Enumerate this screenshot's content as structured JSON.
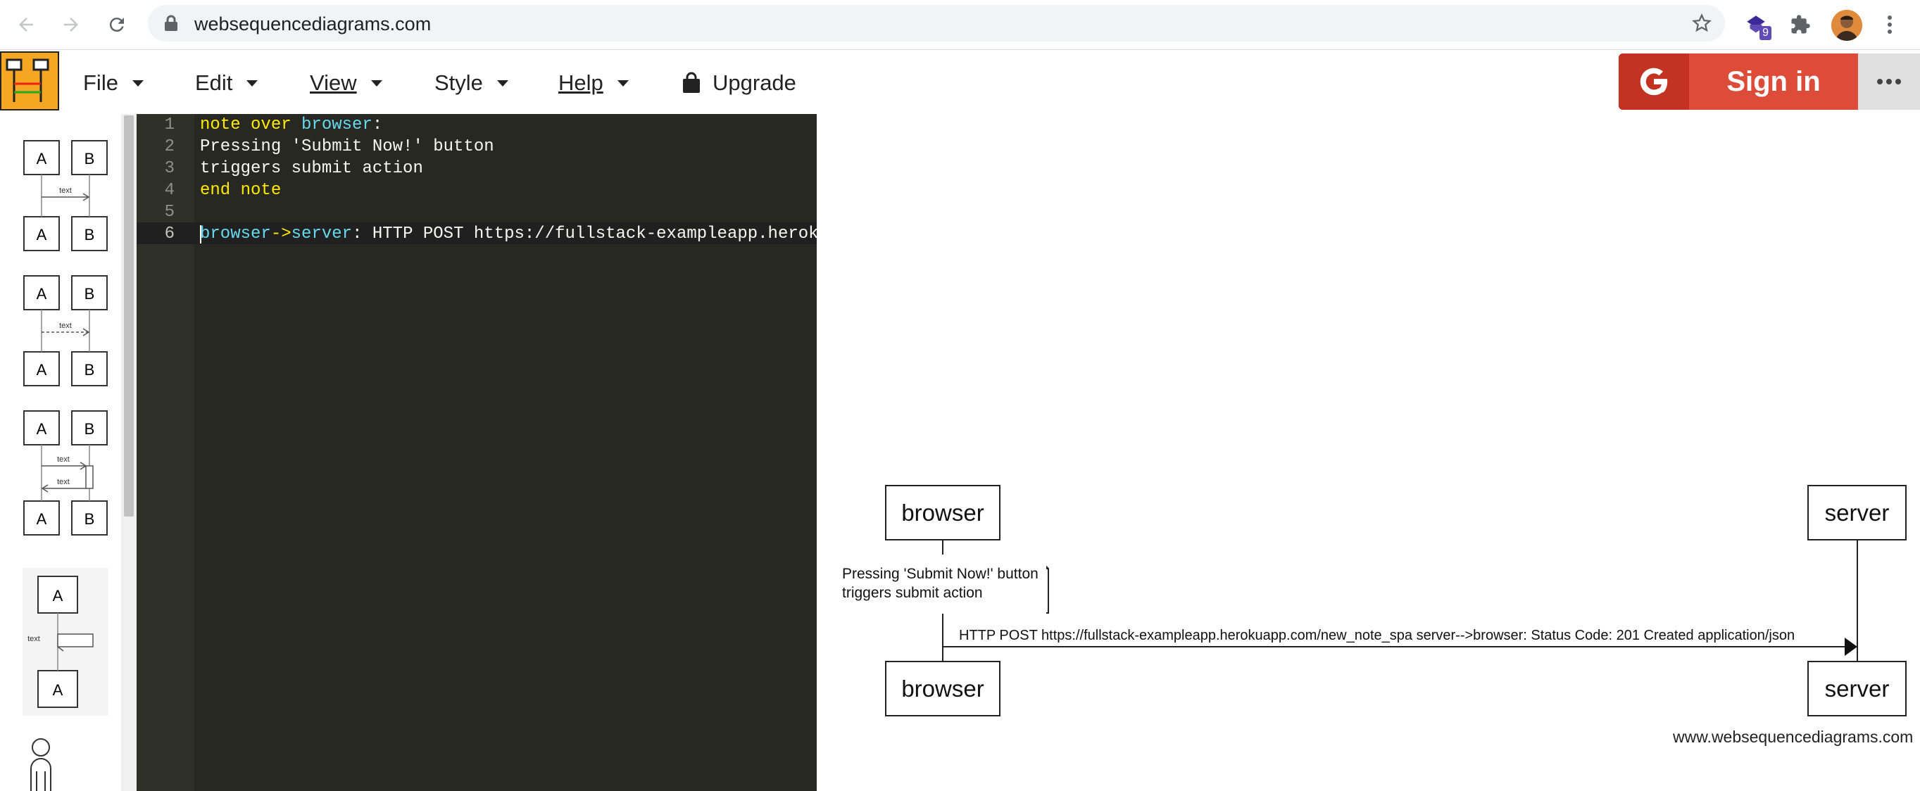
{
  "browser": {
    "url": "websequencediagrams.com",
    "extension_badge": "9",
    "icons": [
      "back-arrow-icon",
      "forward-arrow-icon",
      "reload-icon",
      "lock-icon",
      "bookmark-star-icon",
      "extension-icon",
      "puzzle-icon",
      "kebab-menu-icon"
    ]
  },
  "app": {
    "menu": {
      "file": "File",
      "edit": "Edit",
      "view": "View",
      "style": "Style",
      "help": "Help",
      "upgrade": "Upgrade"
    },
    "signin_label": "Sign in",
    "accent": "#dd4b39"
  },
  "templates": [
    {
      "top": "A",
      "top2": "B",
      "bottom": "A",
      "bottom2": "B",
      "label": "text"
    },
    {
      "top": "A",
      "top2": "B",
      "bottom": "A",
      "bottom2": "B",
      "label": "text"
    },
    {
      "top": "A",
      "top2": "B",
      "bottom": "A",
      "bottom2": "B",
      "label": "text",
      "label2": "text"
    },
    {
      "top": "A",
      "bottom": "A",
      "label": "text"
    }
  ],
  "editor": {
    "line_numbers": [
      "1",
      "2",
      "3",
      "4",
      "5",
      "6"
    ],
    "lines": [
      {
        "k1": "note over",
        "id1": "browser",
        "rest": ":"
      },
      {
        "text": "Pressing 'Submit Now!' button"
      },
      {
        "text": "triggers submit action"
      },
      {
        "k1": "end note"
      },
      {
        "text": ""
      },
      {
        "id1": "browser",
        "k1": "->",
        "id2": "server",
        "rest": ": HTTP POST https://fullstack-exampleapp.herokuapp.com/new_note_spa"
      }
    ]
  },
  "diagram": {
    "participants": [
      "browser",
      "server"
    ],
    "note": [
      "Pressing 'Submit Now!' button",
      "triggers submit action"
    ],
    "message": "HTTP POST https://fullstack-exampleapp.herokuapp.com/new_note_spa server-->browser: Status Code: 201 Created application/json",
    "watermark": "www.websequencediagrams.com"
  }
}
